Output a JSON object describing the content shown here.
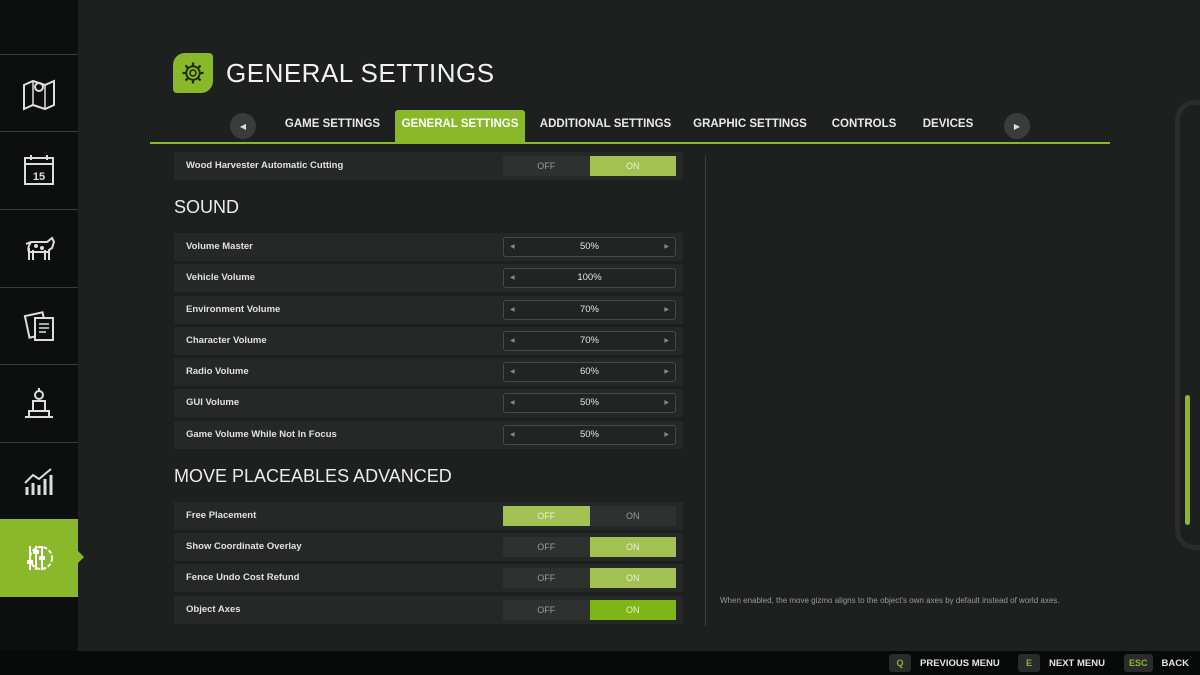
{
  "header": {
    "title": "GENERAL SETTINGS",
    "icon": "gear-icon"
  },
  "tabs": [
    {
      "label": "GAME SETTINGS",
      "active": false
    },
    {
      "label": "GENERAL SETTINGS",
      "active": true
    },
    {
      "label": "ADDITIONAL SETTINGS",
      "active": false
    },
    {
      "label": "GRAPHIC SETTINGS",
      "active": false
    },
    {
      "label": "CONTROLS",
      "active": false
    },
    {
      "label": "DEVICES",
      "active": false
    }
  ],
  "sidebar": {
    "items": [
      {
        "icon": "map-icon"
      },
      {
        "icon": "calendar-icon",
        "calendar_day": "15"
      },
      {
        "icon": "cow-icon"
      },
      {
        "icon": "contracts-icon"
      },
      {
        "icon": "production-icon"
      },
      {
        "icon": "statistics-icon"
      },
      {
        "icon": "settings-sliders-icon",
        "active": true
      }
    ]
  },
  "toggle_labels": {
    "off": "OFF",
    "on": "ON"
  },
  "stepper_arrows": {
    "left": "◀",
    "right": "▶"
  },
  "wood_harvester": {
    "label": "Wood Harvester Automatic Cutting",
    "value": "ON"
  },
  "sound": {
    "title": "SOUND",
    "rows": [
      {
        "label": "Volume Master",
        "value": "50%"
      },
      {
        "label": "Vehicle Volume",
        "value": "100%"
      },
      {
        "label": "Environment Volume",
        "value": "70%"
      },
      {
        "label": "Character Volume",
        "value": "70%"
      },
      {
        "label": "Radio Volume",
        "value": "60%"
      },
      {
        "label": "GUI Volume",
        "value": "50%"
      },
      {
        "label": "Game Volume While Not In Focus",
        "value": "50%"
      }
    ]
  },
  "move_placeables": {
    "title": "MOVE PLACEABLES ADVANCED",
    "rows": [
      {
        "label": "Free Placement",
        "value": "OFF"
      },
      {
        "label": "Show Coordinate Overlay",
        "value": "ON"
      },
      {
        "label": "Fence Undo Cost Refund",
        "value": "ON"
      },
      {
        "label": "Object Axes",
        "value": "ON"
      }
    ]
  },
  "help_text": "When enabled, the move gizmo aligns to the object's own axes by default instead of world axes.",
  "bottom_bar": [
    {
      "key": "Q",
      "label": "PREVIOUS MENU"
    },
    {
      "key": "E",
      "label": "NEXT MENU"
    },
    {
      "key": "ESC",
      "label": "BACK"
    }
  ],
  "colors": {
    "accent": "#89b82a",
    "background": "#1e1f1f",
    "sidebar": "#0d0e0e"
  }
}
